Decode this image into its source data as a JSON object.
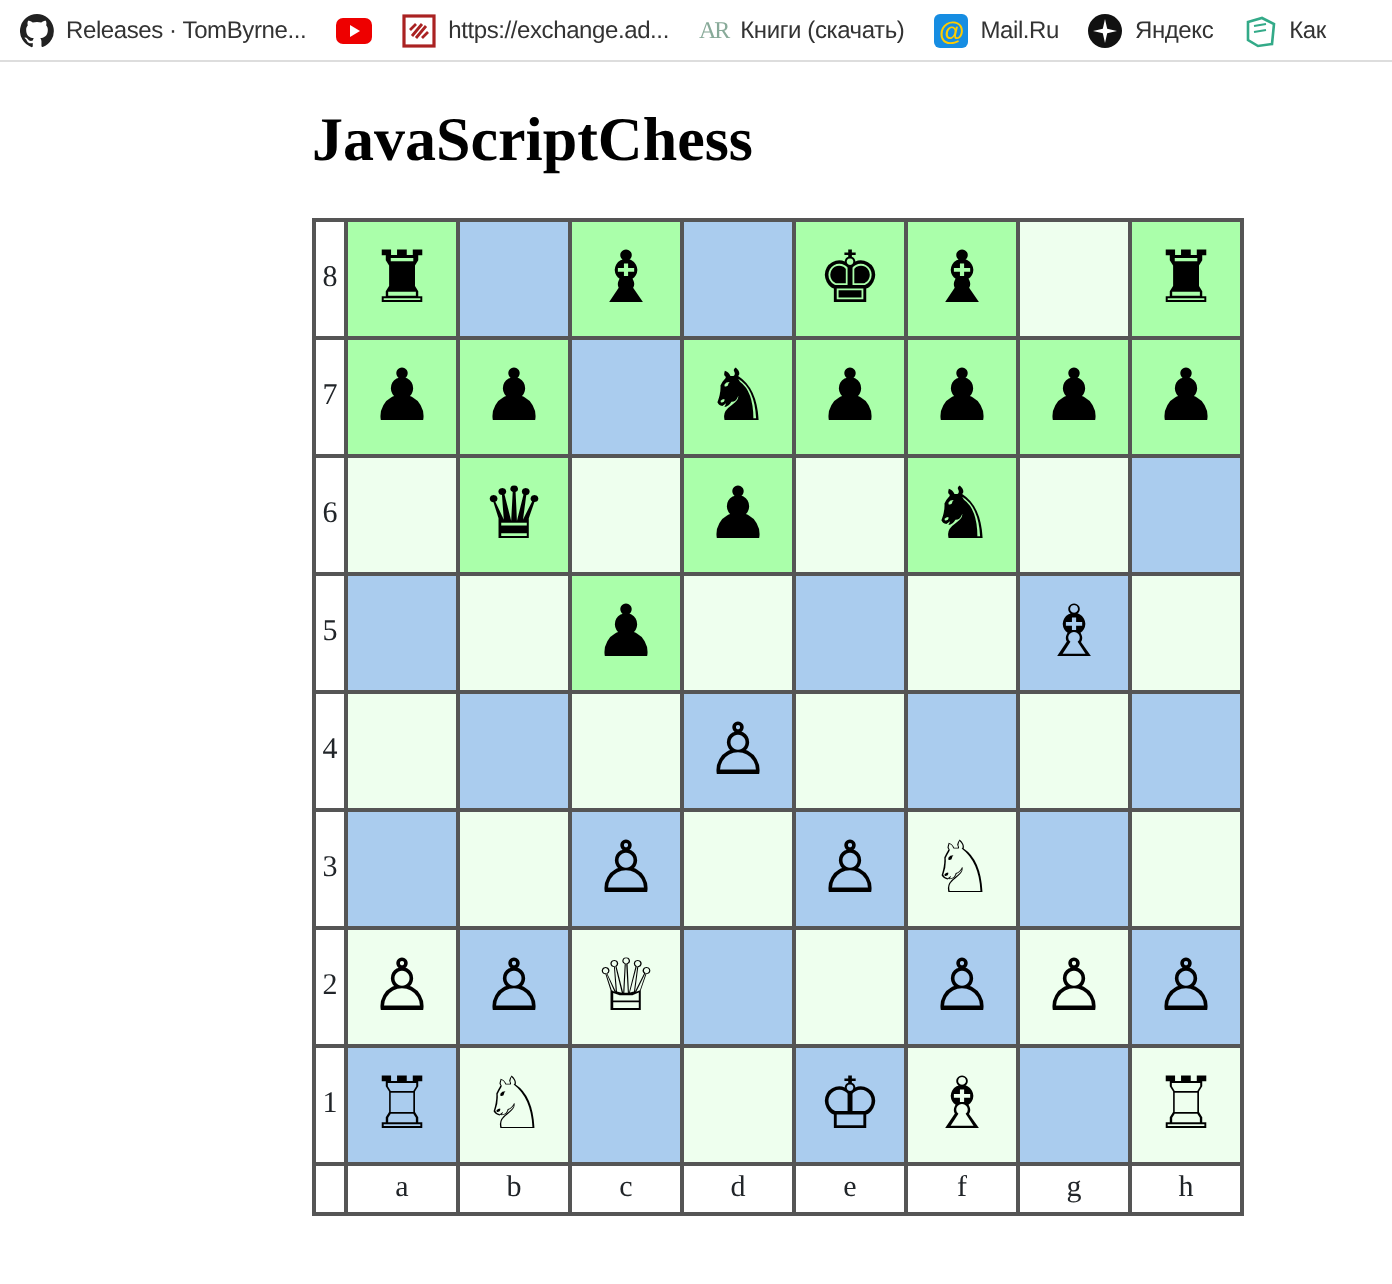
{
  "bookmarks": [
    {
      "kind": "github",
      "label": "Releases · TomByrne..."
    },
    {
      "kind": "youtube"
    },
    {
      "kind": "exchange",
      "label": "https://exchange.ad..."
    },
    {
      "kind": "letters",
      "icon_text": "AR",
      "label": "Книги (скачать)"
    },
    {
      "kind": "mail",
      "icon_text": "@",
      "label": "Mail.Ru"
    },
    {
      "kind": "yandex",
      "label": "Яндекс"
    },
    {
      "kind": "book",
      "label": "Как"
    }
  ],
  "title": "JavaScriptChess",
  "board": {
    "ranks": [
      {
        "label": "8",
        "cells": [
          {
            "color": "#aaffaa",
            "piece": "♜"
          },
          {
            "color": "#aaccee"
          },
          {
            "color": "#aaffaa",
            "piece": "♝"
          },
          {
            "color": "#aaccee"
          },
          {
            "color": "#aaffaa",
            "piece": "♚"
          },
          {
            "color": "#aaffaa",
            "piece": "♝"
          },
          {
            "color": "#eeffee"
          },
          {
            "color": "#aaffaa",
            "piece": "♜"
          }
        ]
      },
      {
        "label": "7",
        "cells": [
          {
            "color": "#aaffaa",
            "piece": "♟"
          },
          {
            "color": "#aaffaa",
            "piece": "♟"
          },
          {
            "color": "#aaccee"
          },
          {
            "color": "#aaffaa",
            "piece": "♞"
          },
          {
            "color": "#aaffaa",
            "piece": "♟"
          },
          {
            "color": "#aaffaa",
            "piece": "♟"
          },
          {
            "color": "#aaffaa",
            "piece": "♟"
          },
          {
            "color": "#aaffaa",
            "piece": "♟"
          }
        ]
      },
      {
        "label": "6",
        "cells": [
          {
            "color": "#eeffee"
          },
          {
            "color": "#aaffaa",
            "piece": "♛"
          },
          {
            "color": "#eeffee"
          },
          {
            "color": "#aaffaa",
            "piece": "♟"
          },
          {
            "color": "#eeffee"
          },
          {
            "color": "#aaffaa",
            "piece": "♞"
          },
          {
            "color": "#eeffee"
          },
          {
            "color": "#aaccee"
          }
        ]
      },
      {
        "label": "5",
        "cells": [
          {
            "color": "#aaccee"
          },
          {
            "color": "#eeffee"
          },
          {
            "color": "#aaffaa",
            "piece": "♟"
          },
          {
            "color": "#eeffee"
          },
          {
            "color": "#aaccee"
          },
          {
            "color": "#eeffee"
          },
          {
            "color": "#aaccee",
            "piece": "♗"
          },
          {
            "color": "#eeffee"
          }
        ]
      },
      {
        "label": "4",
        "cells": [
          {
            "color": "#eeffee"
          },
          {
            "color": "#aaccee"
          },
          {
            "color": "#eeffee"
          },
          {
            "color": "#aaccee",
            "piece": "♙"
          },
          {
            "color": "#eeffee"
          },
          {
            "color": "#aaccee"
          },
          {
            "color": "#eeffee"
          },
          {
            "color": "#aaccee"
          }
        ]
      },
      {
        "label": "3",
        "cells": [
          {
            "color": "#aaccee"
          },
          {
            "color": "#eeffee"
          },
          {
            "color": "#aaccee",
            "piece": "♙"
          },
          {
            "color": "#eeffee"
          },
          {
            "color": "#aaccee",
            "piece": "♙"
          },
          {
            "color": "#eeffee",
            "piece": "♘"
          },
          {
            "color": "#aaccee"
          },
          {
            "color": "#eeffee"
          }
        ]
      },
      {
        "label": "2",
        "cells": [
          {
            "color": "#eeffee",
            "piece": "♙"
          },
          {
            "color": "#aaccee",
            "piece": "♙"
          },
          {
            "color": "#eeffee",
            "piece": "♕"
          },
          {
            "color": "#aaccee"
          },
          {
            "color": "#eeffee"
          },
          {
            "color": "#aaccee",
            "piece": "♙"
          },
          {
            "color": "#eeffee",
            "piece": "♙"
          },
          {
            "color": "#aaccee",
            "piece": "♙"
          }
        ]
      },
      {
        "label": "1",
        "cells": [
          {
            "color": "#aaccee",
            "piece": "♖"
          },
          {
            "color": "#eeffee",
            "piece": "♘"
          },
          {
            "color": "#aaccee"
          },
          {
            "color": "#eeffee"
          },
          {
            "color": "#aaccee",
            "piece": "♔"
          },
          {
            "color": "#eeffee",
            "piece": "♗"
          },
          {
            "color": "#aaccee"
          },
          {
            "color": "#eeffee",
            "piece": "♖"
          }
        ]
      }
    ],
    "files": [
      "a",
      "b",
      "c",
      "d",
      "e",
      "f",
      "g",
      "h"
    ]
  }
}
